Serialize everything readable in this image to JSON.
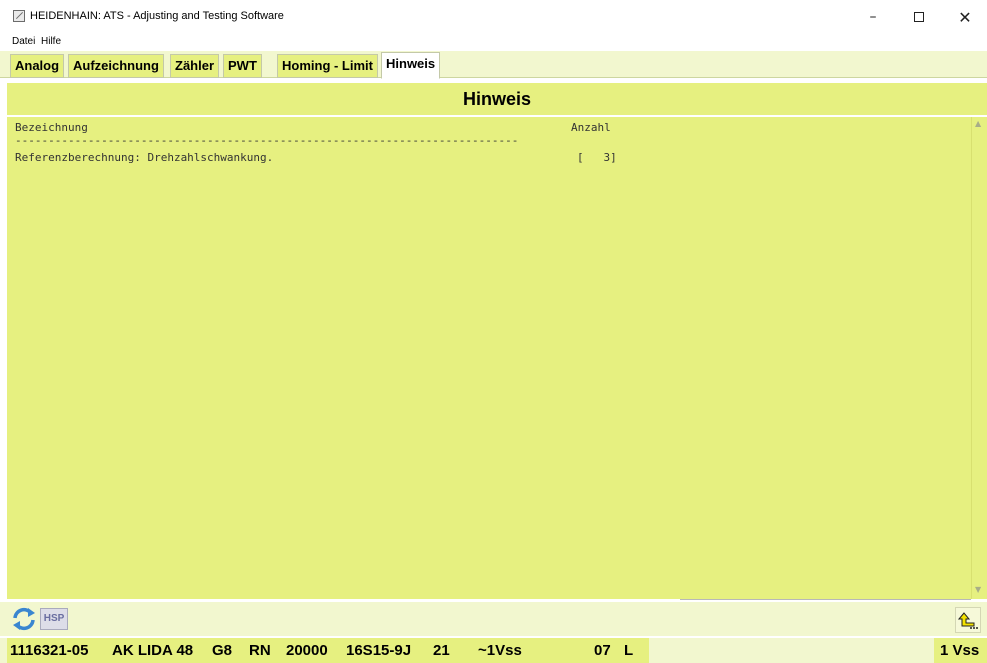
{
  "window": {
    "title": "HEIDENHAIN: ATS - Adjusting and Testing Software",
    "minimize": "–",
    "close": "✕"
  },
  "menu": [
    "Datei",
    "Hilfe"
  ],
  "tabs": [
    "Analog",
    "Aufzeichnung",
    "Zähler",
    "PWT",
    "Homing - Limit",
    "Hinweis"
  ],
  "active_tab": "Hinweis",
  "panel": {
    "title": "Hinweis",
    "header_label": "Bezeichnung",
    "header_count": "Anzahl",
    "separator": "----------------------------------------------------------------------------",
    "rows": [
      {
        "label": "Referenzberechnung: Drehzahlschwankung.",
        "count": "[   3]"
      }
    ]
  },
  "toolbar": {
    "refresh_icon": "refresh-icon",
    "hsp_label": "HSP",
    "back_icon": "return-arrow-icon"
  },
  "status": {
    "id": "1116321-05",
    "device": "AK LIDA 48",
    "g": "G8",
    "rn": "RN",
    "lines": "20000",
    "code": "16S15-9J",
    "n": "21",
    "signal": "~1Vss",
    "num": "07",
    "l": "L",
    "right": "1 Vss"
  },
  "colors": {
    "panel_bg": "#e6f080",
    "bar_bg": "#f2f7cf",
    "hsp_text": "#6a6ea0"
  }
}
